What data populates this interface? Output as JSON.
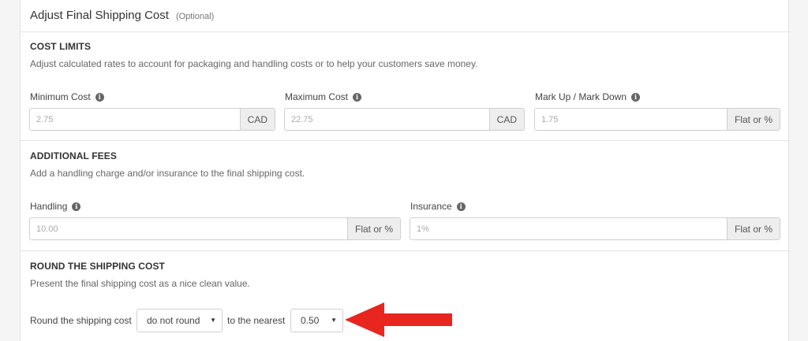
{
  "header": {
    "title": "Adjust Final Shipping Cost",
    "optional": "(Optional)"
  },
  "cost_limits": {
    "title": "COST LIMITS",
    "description": "Adjust calculated rates to account for packaging and handling costs or to help your customers save money.",
    "minimum": {
      "label": "Minimum Cost",
      "placeholder": "2.75",
      "addon": "CAD"
    },
    "maximum": {
      "label": "Maximum Cost",
      "placeholder": "22.75",
      "addon": "CAD"
    },
    "markup": {
      "label": "Mark Up / Mark Down",
      "placeholder": "1.75",
      "addon": "Flat or %"
    }
  },
  "additional_fees": {
    "title": "ADDITIONAL FEES",
    "description": "Add a handling charge and/or insurance to the final shipping cost.",
    "handling": {
      "label": "Handling",
      "placeholder": "10.00",
      "addon": "Flat or %"
    },
    "insurance": {
      "label": "Insurance",
      "placeholder": "1%",
      "addon": "Flat or %"
    }
  },
  "rounding": {
    "title": "ROUND THE SHIPPING COST",
    "description": "Present the final shipping cost as a nice clean value.",
    "prefix": "Round the shipping cost",
    "mode_value": "do not round",
    "middle": "to the nearest",
    "nearest_value": "0.50"
  },
  "icons": {
    "info": "info-icon",
    "caret": "caret-down-icon",
    "annotation": "red-arrow-icon"
  },
  "colors": {
    "annotation_arrow": "#e8261f",
    "addon_bg": "#eeeeee",
    "border": "#cfcfcf"
  }
}
